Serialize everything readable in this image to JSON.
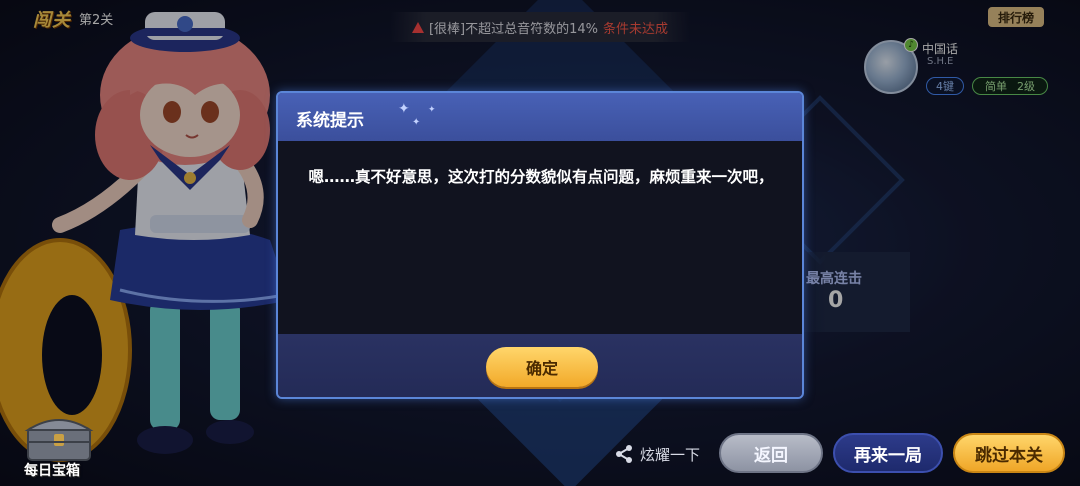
{
  "header": {
    "stage_logo": "闯关",
    "stage_number": "第2关",
    "warning": {
      "text": "[很棒]不超过总音符数的14%",
      "status": "条件未达成"
    },
    "leaderboard_label": "排行榜"
  },
  "song": {
    "title": "中国话",
    "artist": "S.H.E",
    "keys": "4键",
    "difficulty": "简单",
    "level": "2级"
  },
  "stats": {
    "max_combo_label": "最高连击",
    "max_combo_value": "0"
  },
  "dialog": {
    "title": "系统提示",
    "message": "嗯……真不好意思，这次打的分数貌似有点问题，麻烦重来一次吧，",
    "confirm_label": "确定"
  },
  "bottom": {
    "daily_chest_label": "每日宝箱",
    "share_label": "炫耀一下",
    "back_label": "返回",
    "retry_label": "再来一局",
    "skip_label": "跳过本关"
  },
  "colors": {
    "accent_gold": "#f2a929",
    "warning_red": "#ff5a4a",
    "dialog_border": "#5b86d8"
  }
}
